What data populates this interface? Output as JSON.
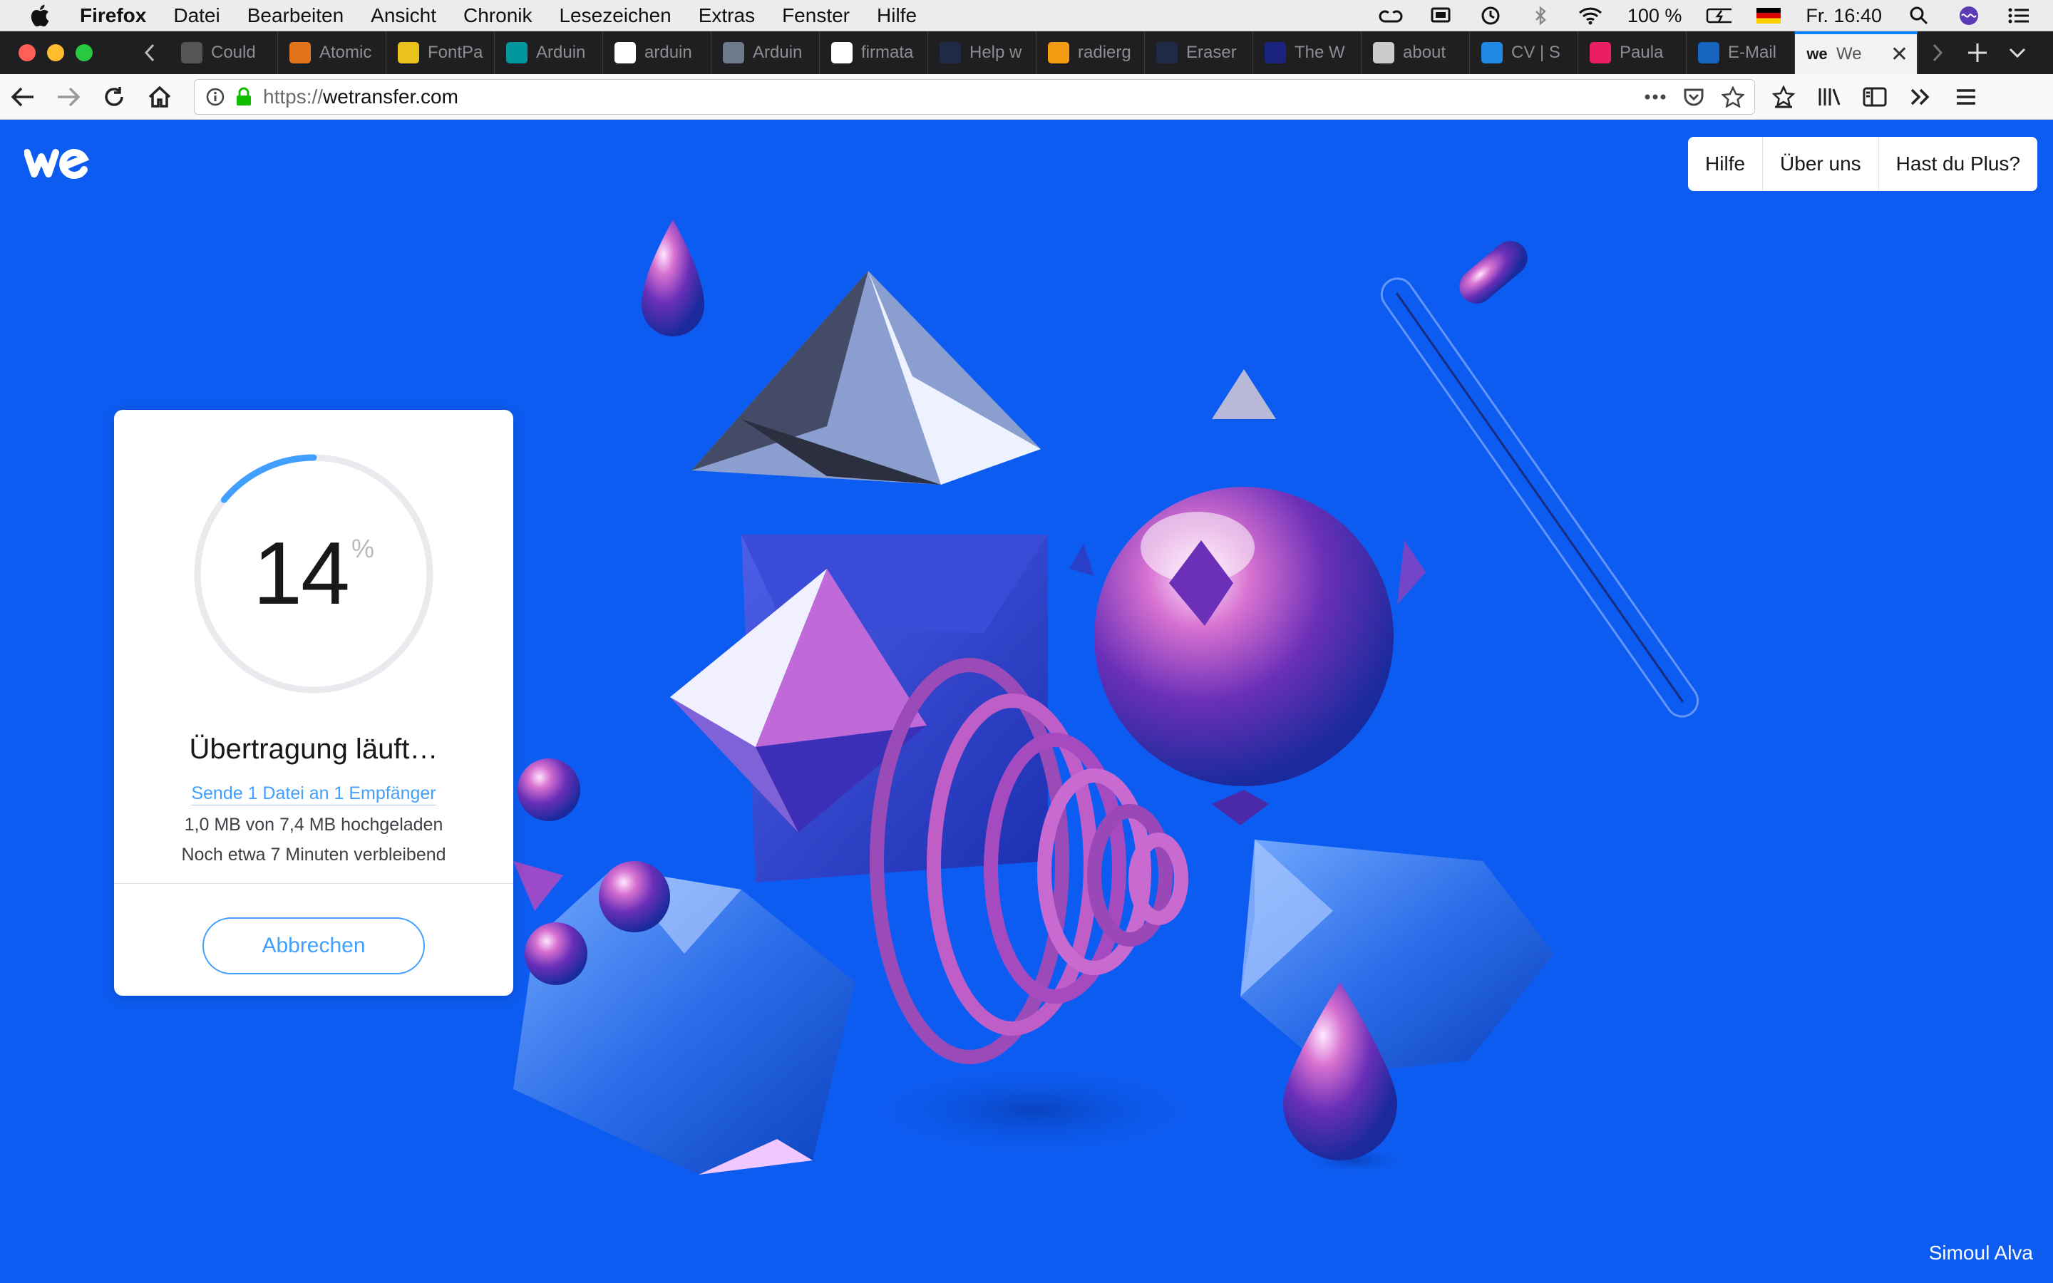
{
  "menubar": {
    "app_name": "Firefox",
    "items": [
      "Datei",
      "Bearbeiten",
      "Ansicht",
      "Chronik",
      "Lesezeichen",
      "Extras",
      "Fenster",
      "Hilfe"
    ],
    "battery": "100 %",
    "clock": "Fr. 16:40"
  },
  "tabs": [
    {
      "label": "Could",
      "color": "#555"
    },
    {
      "label": "Atomic",
      "color": "#e2751c"
    },
    {
      "label": "FontPa",
      "color": "#e9c31b"
    },
    {
      "label": "Arduin",
      "color": "#00979c"
    },
    {
      "label": "arduin",
      "color": "#ffffff"
    },
    {
      "label": "Arduin",
      "color": "#6c7a8c"
    },
    {
      "label": "firmata",
      "color": "#ffffff"
    },
    {
      "label": "Help w",
      "color": "#1f2a44"
    },
    {
      "label": "radierg",
      "color": "#f39c12"
    },
    {
      "label": "Eraser",
      "color": "#1f2a44"
    },
    {
      "label": "The W",
      "color": "#1a237e"
    },
    {
      "label": "about",
      "color": "#cccccc"
    },
    {
      "label": "CV | S",
      "color": "#1e88e5"
    },
    {
      "label": "Paula",
      "color": "#e91e63"
    },
    {
      "label": "E-Mail",
      "color": "#1565c0"
    }
  ],
  "active_tab": {
    "label": "We"
  },
  "address": {
    "scheme": "https://",
    "host": "wetransfer.com"
  },
  "topnav": {
    "help": "Hilfe",
    "about": "Über uns",
    "plus": "Hast du Plus?"
  },
  "transfer": {
    "progress": 14,
    "progress_label": "14",
    "percent_sign": "%",
    "title": "Übertragung läuft…",
    "subtitle": "Sende 1 Datei an 1 Empfänger",
    "uploaded": "1,0 MB von 7,4 MB hochgeladen",
    "remaining": "Noch etwa 7 Minuten verbleibend",
    "cancel_label": "Abbrechen"
  },
  "credit": "Simoul Alva",
  "colors": {
    "background": "#0d5cf2",
    "accent": "#409fff"
  }
}
